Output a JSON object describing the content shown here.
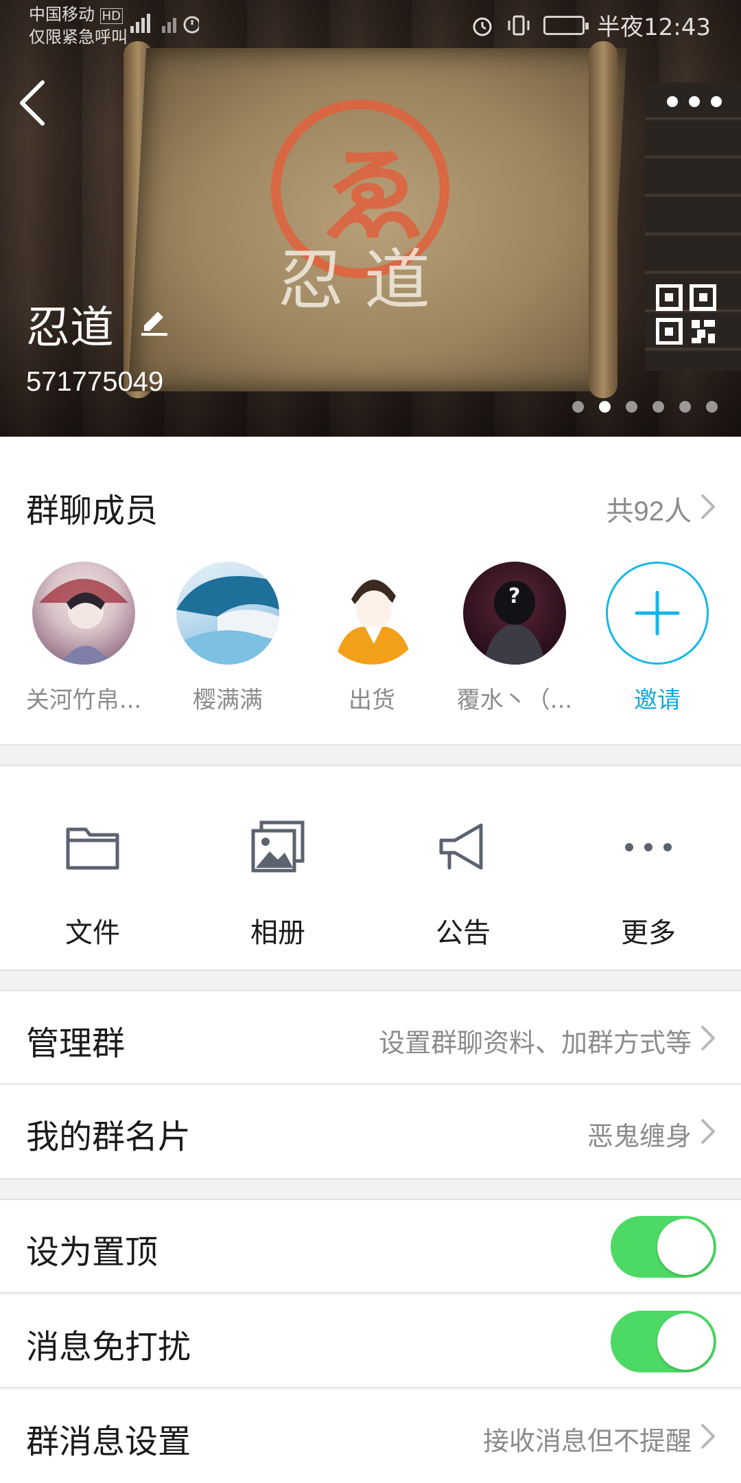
{
  "status_bar": {
    "carrier_line1": "中国移动",
    "carrier_badge": "HD",
    "carrier_line2": "仅限紧急呼叫",
    "time": "半夜12:43",
    "icon_names": [
      "signal-icon",
      "timer-icon",
      "alarm-icon",
      "vibrate-icon",
      "battery-icon"
    ]
  },
  "header": {
    "group_name": "忍道",
    "group_id": "571775049",
    "page_count": 6,
    "active_page": 1,
    "back_icon": "chevron-left-icon",
    "more_icon": "ellipsis-icon",
    "qr_icon": "qr-code-icon",
    "edit_icon": "pencil-icon"
  },
  "members": {
    "title": "群聊成员",
    "count_label": "共92人",
    "items": [
      {
        "name": "关河竹帛..."
      },
      {
        "name": "樱满满"
      },
      {
        "name": "出货"
      },
      {
        "name": "覆水丶（..."
      }
    ],
    "invite_label": "邀请"
  },
  "tools": [
    {
      "label": "文件",
      "icon": "folder-icon"
    },
    {
      "label": "相册",
      "icon": "photo-album-icon"
    },
    {
      "label": "公告",
      "icon": "megaphone-icon"
    },
    {
      "label": "更多",
      "icon": "more-icon"
    }
  ],
  "settings": {
    "manage_label": "管理群",
    "manage_value": "设置群聊资料、加群方式等",
    "card_label": "我的群名片",
    "card_value": "恶鬼缠身",
    "pin_label": "设为置顶",
    "pin_on": true,
    "dnd_label": "消息免打扰",
    "dnd_on": true,
    "msg_label": "群消息设置",
    "msg_value": "接收消息但不提醒"
  },
  "colors": {
    "accent": "#12a7d9",
    "toggle_on": "#4cd964",
    "secondary_text": "#8b8b8b",
    "seal": "#e0603c"
  }
}
